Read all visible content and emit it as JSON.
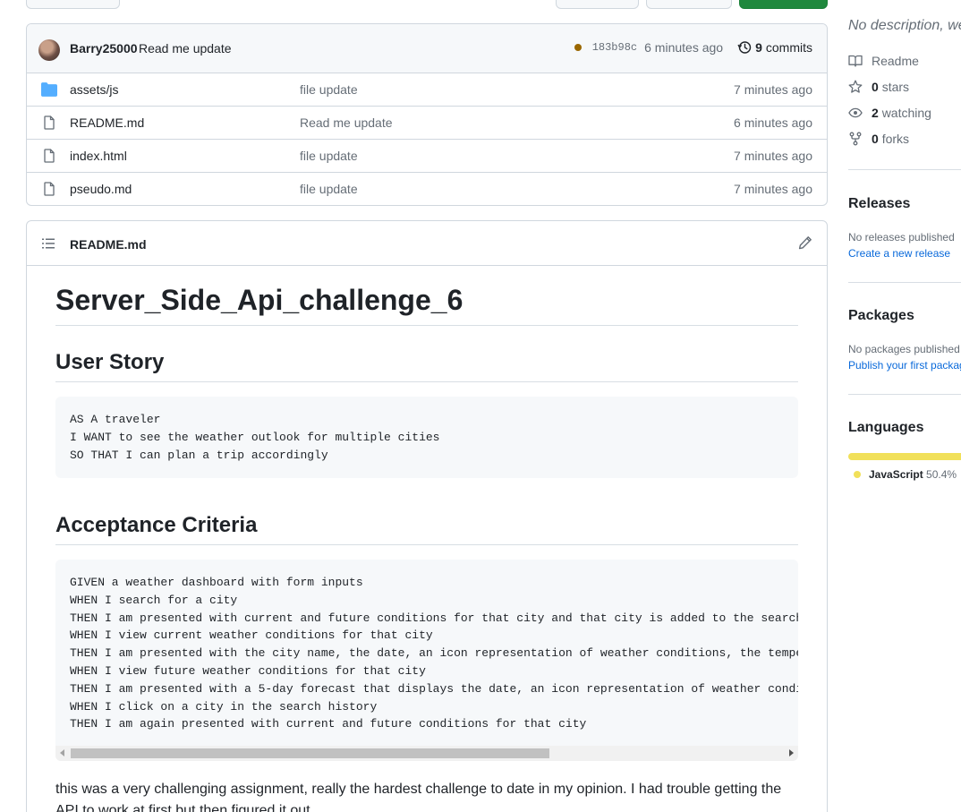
{
  "commit": {
    "author": "Barry25000",
    "message": "Read me update",
    "sha": "183b98c",
    "time": "6 minutes ago",
    "commits_count": "9",
    "commits_label": "commits",
    "status_color": "#9a6700"
  },
  "files": [
    {
      "name": "assets/js",
      "type": "folder",
      "message": "file update",
      "time": "7 minutes ago"
    },
    {
      "name": "README.md",
      "type": "file",
      "message": "Read me update",
      "time": "6 minutes ago"
    },
    {
      "name": "index.html",
      "type": "file",
      "message": "file update",
      "time": "7 minutes ago"
    },
    {
      "name": "pseudo.md",
      "type": "file",
      "message": "file update",
      "time": "7 minutes ago"
    }
  ],
  "readme": {
    "filename": "README.md",
    "h1": "Server_Side_Api_challenge_6",
    "h2_user_story": "User Story",
    "user_story_code": "AS A traveler\nI WANT to see the weather outlook for multiple cities\nSO THAT I can plan a trip accordingly",
    "h2_acceptance": "Acceptance Criteria",
    "acceptance_code": "GIVEN a weather dashboard with form inputs\nWHEN I search for a city\nTHEN I am presented with current and future conditions for that city and that city is added to the search history\nWHEN I view current weather conditions for that city\nTHEN I am presented with the city name, the date, an icon representation of weather conditions, the temperature\nWHEN I view future weather conditions for that city\nTHEN I am presented with a 5-day forecast that displays the date, an icon representation of weather conditions\nWHEN I click on a city in the search history\nTHEN I am again presented with current and future conditions for that city",
    "paragraph": "this was a very challenging assignment, really the hardest challenge to date in my opinion. I had trouble getting the API to work at first but then figured it out."
  },
  "sidebar": {
    "description": "No description, website, or topics provided.",
    "readme_label": "Readme",
    "stars_count": "0",
    "stars_label": "stars",
    "watching_count": "2",
    "watching_label": "watching",
    "forks_count": "0",
    "forks_label": "forks",
    "releases_title": "Releases",
    "releases_none": "No releases published",
    "releases_link": "Create a new release",
    "packages_title": "Packages",
    "packages_none": "No packages published",
    "packages_link": "Publish your first package",
    "languages_title": "Languages",
    "language_name": "JavaScript",
    "language_pct": "50.4%",
    "language_color": "#f1e05a"
  }
}
